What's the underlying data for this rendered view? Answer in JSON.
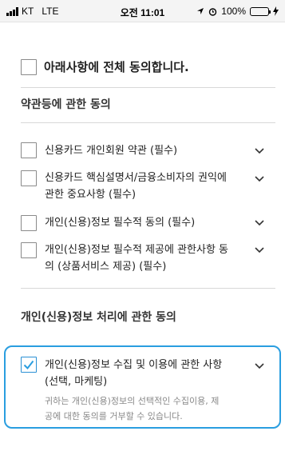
{
  "status_bar": {
    "carrier": "KT",
    "network": "LTE",
    "time": "오전 11:01",
    "battery": "100%",
    "battery_level": 1.0,
    "icons": [
      "signal-icon",
      "location-icon",
      "alarm-icon",
      "battery-icon",
      "charging-icon"
    ]
  },
  "agree_all": {
    "label": "아래사항에 전체 동의합니다.",
    "checked": false
  },
  "terms_section": {
    "title": "약관등에 관한 동의",
    "items": [
      {
        "lines": [
          "신용카드 개인회원 약관 (필수)"
        ],
        "checked": false
      },
      {
        "lines": [
          "신용카드 핵심설명서/금융소비자의 권익에",
          "관한 중요사항 (필수)"
        ],
        "checked": false
      },
      {
        "lines": [
          "개인(신용)정보 필수적 동의 (필수)"
        ],
        "checked": false
      },
      {
        "lines": [
          "개인(신용)정보 필수적 제공에 관한사항 동",
          "의 (상품서비스 제공) (필수)"
        ],
        "checked": false
      }
    ]
  },
  "processing_section": {
    "title": "개인(신용)정보 처리에 관한 동의",
    "items": [
      {
        "lines": [
          "개인(신용)정보 수집 및 이용에 관한 사항",
          "(선택, 마케팅)"
        ],
        "checked": true,
        "description": [
          "귀하는 개인(신용)정보의 선택적인 수집이용, 제",
          "공에 대한 동의를 거부할 수 있습니다."
        ]
      }
    ]
  },
  "colors": {
    "accent": "#2a9ee0",
    "checkbox_border": "#8a8a8a",
    "divider": "#d8d8d8",
    "description_text": "#888888"
  }
}
